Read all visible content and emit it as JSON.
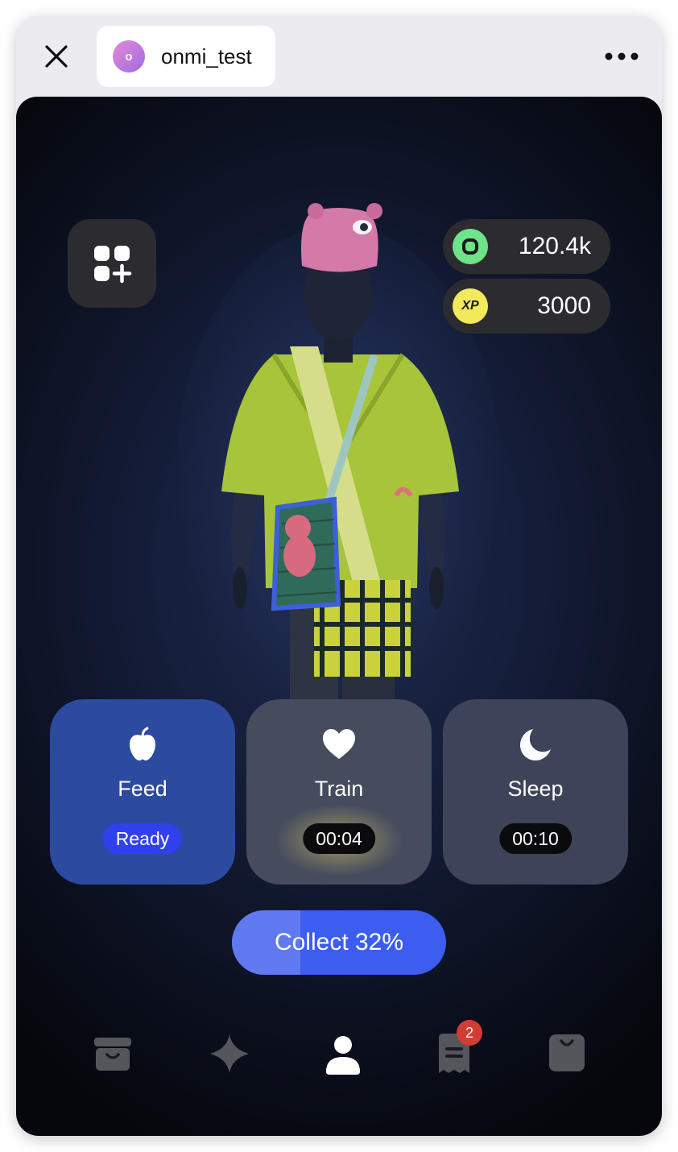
{
  "topbar": {
    "close_icon": "close-icon",
    "app": {
      "avatar_letter": "o",
      "name": "onmi_test"
    },
    "more_icon": "more-horizontal-icon"
  },
  "currency": {
    "coins": {
      "icon": "onmi-coin-icon",
      "value": "120.4k",
      "color": "#6fe38a"
    },
    "xp": {
      "icon": "xp-badge-icon",
      "label": "XP",
      "value": "3000",
      "color": "#f2ea5a"
    }
  },
  "customize_icon": "add-widget-icon",
  "actions": [
    {
      "label": "Feed",
      "icon": "apple-icon",
      "status": "Ready",
      "color": "#3140ee"
    },
    {
      "label": "Train",
      "icon": "heart-icon",
      "status": "00:04"
    },
    {
      "label": "Sleep",
      "icon": "moon-icon",
      "status": "00:10"
    }
  ],
  "collect": {
    "label": "Collect 32%",
    "progress": 0.32
  },
  "nav": {
    "items": [
      {
        "name": "shop-box-icon"
      },
      {
        "name": "sparkle-icon"
      },
      {
        "name": "profile-icon",
        "active": true
      },
      {
        "name": "receipt-icon",
        "badge": "2"
      },
      {
        "name": "bag-icon"
      }
    ]
  }
}
